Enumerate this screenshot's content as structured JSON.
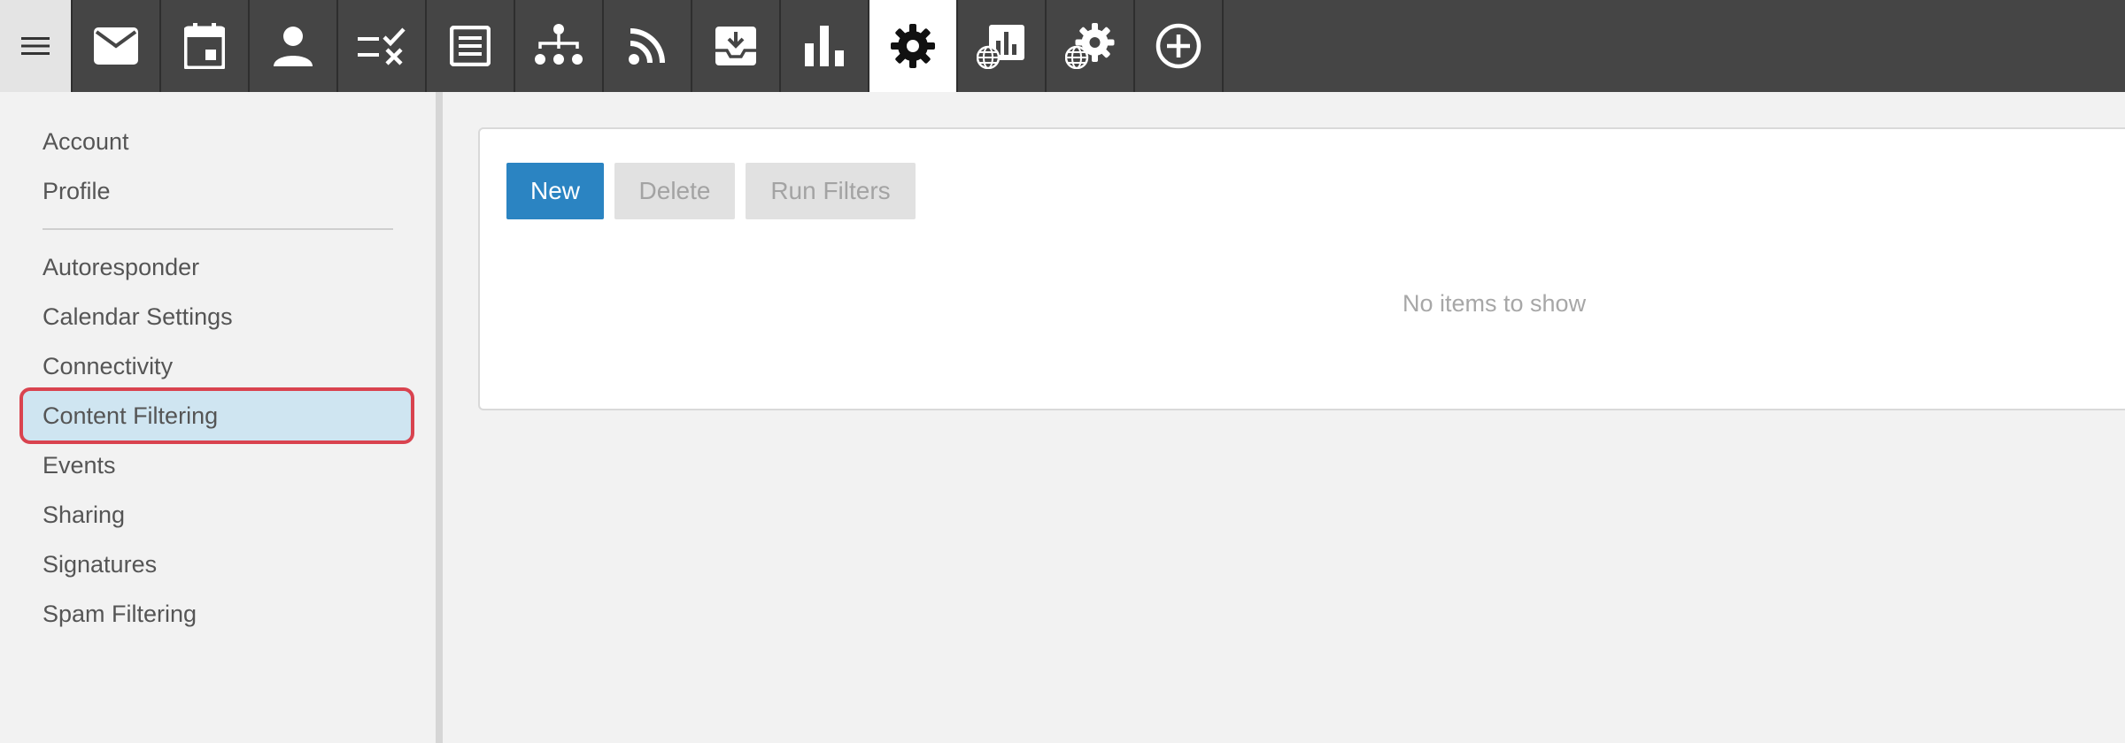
{
  "toolbar": {
    "items": [
      {
        "name": "email",
        "icon": "envelope-icon",
        "active": false
      },
      {
        "name": "calendar",
        "icon": "calendar-icon",
        "active": false
      },
      {
        "name": "contacts",
        "icon": "person-icon",
        "active": false
      },
      {
        "name": "tasks",
        "icon": "task-list-icon",
        "active": false
      },
      {
        "name": "notes",
        "icon": "notes-icon",
        "active": false
      },
      {
        "name": "organization",
        "icon": "org-chart-icon",
        "active": false
      },
      {
        "name": "feeds",
        "icon": "rss-icon",
        "active": false
      },
      {
        "name": "archive",
        "icon": "inbox-download-icon",
        "active": false
      },
      {
        "name": "reports",
        "icon": "bar-chart-icon",
        "active": false
      },
      {
        "name": "settings",
        "icon": "gear-icon",
        "active": true
      },
      {
        "name": "domain-reports",
        "icon": "globe-report-icon",
        "active": false
      },
      {
        "name": "domain-settings",
        "icon": "globe-gear-icon",
        "active": false
      },
      {
        "name": "add",
        "icon": "plus-circle-icon",
        "active": false
      }
    ],
    "colors": {
      "background": "#454545",
      "active_background": "#ffffff"
    }
  },
  "sidebar": {
    "group1": [
      "Account",
      "Profile"
    ],
    "group2": [
      "Autoresponder",
      "Calendar Settings",
      "Connectivity",
      "Content Filtering",
      "Events",
      "Sharing",
      "Signatures",
      "Spam Filtering"
    ],
    "selected": "Content Filtering",
    "colors": {
      "selected_background": "#cfe5f1",
      "highlight_border": "#d9434f"
    }
  },
  "main": {
    "buttons": {
      "new": "New",
      "delete": "Delete",
      "run_filters": "Run Filters"
    },
    "empty_message": "No items to show",
    "colors": {
      "primary": "#2b84c2",
      "disabled": "#e1e1e1"
    }
  }
}
